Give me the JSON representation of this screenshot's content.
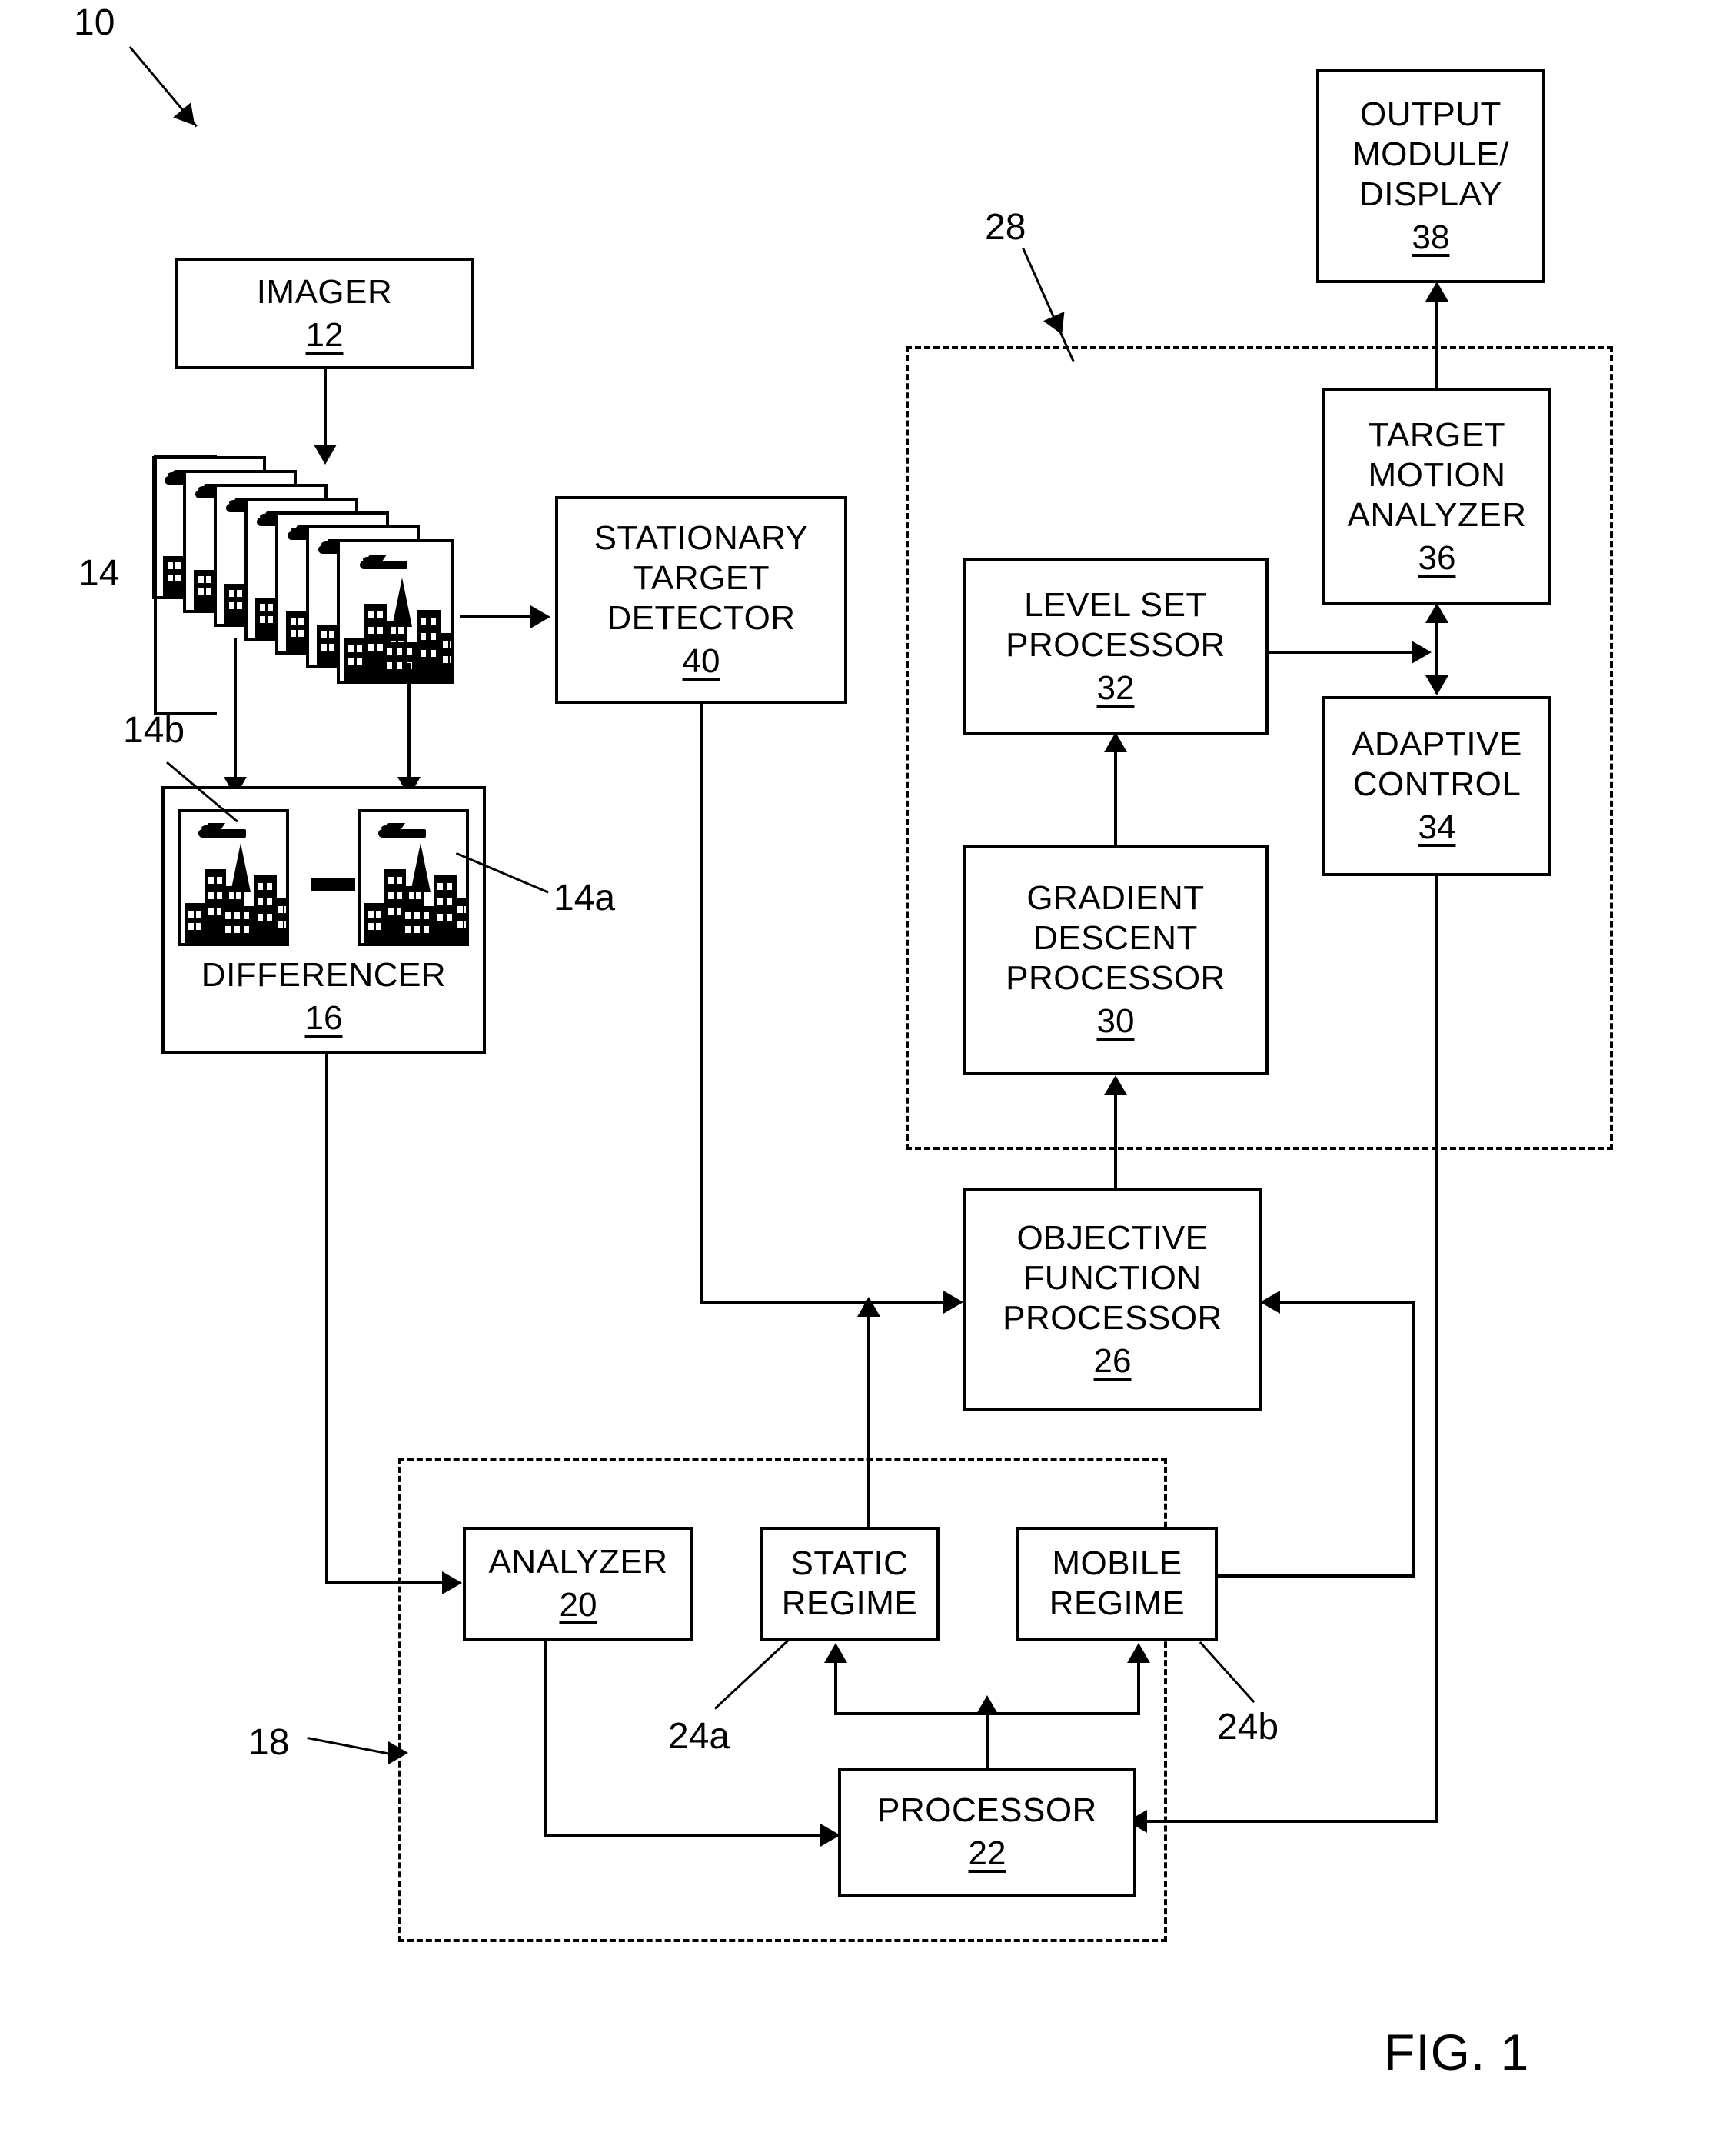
{
  "figure": {
    "caption": "FIG. 1",
    "system_ref": "10"
  },
  "blocks": {
    "imager": {
      "label": "IMAGER",
      "num": "12"
    },
    "stationary": {
      "label": "STATIONARY\nTARGET\nDETECTOR",
      "num": "40"
    },
    "differencer": {
      "label": "DIFFERENCER",
      "num": "16"
    },
    "output": {
      "label": "OUTPUT\nMODULE/\nDISPLAY",
      "num": "38"
    },
    "target_motion": {
      "label": "TARGET\nMOTION\nANALYZER",
      "num": "36"
    },
    "level_set": {
      "label": "LEVEL SET\nPROCESSOR",
      "num": "32"
    },
    "adaptive_control": {
      "label": "ADAPTIVE\nCONTROL",
      "num": "34"
    },
    "gradient_descent": {
      "label": "GRADIENT\nDESCENT\nPROCESSOR",
      "num": "30"
    },
    "objective_function": {
      "label": "OBJECTIVE\nFUNCTION\nPROCESSOR",
      "num": "26"
    },
    "analyzer": {
      "label": "ANALYZER",
      "num": "20"
    },
    "static_regime": {
      "label": "STATIC\nREGIME",
      "num": ""
    },
    "mobile_regime": {
      "label": "MOBILE\nREGIME",
      "num": ""
    },
    "processor": {
      "label": "PROCESSOR",
      "num": "22"
    }
  },
  "refs": {
    "system": "10",
    "image_stack": "14",
    "image_a": "14a",
    "image_b": "14b",
    "regime_a": "24a",
    "regime_b": "24b",
    "regime_group": "18",
    "tracker_group": "28"
  },
  "colors": {
    "ink": "#000000",
    "paper": "#ffffff"
  }
}
